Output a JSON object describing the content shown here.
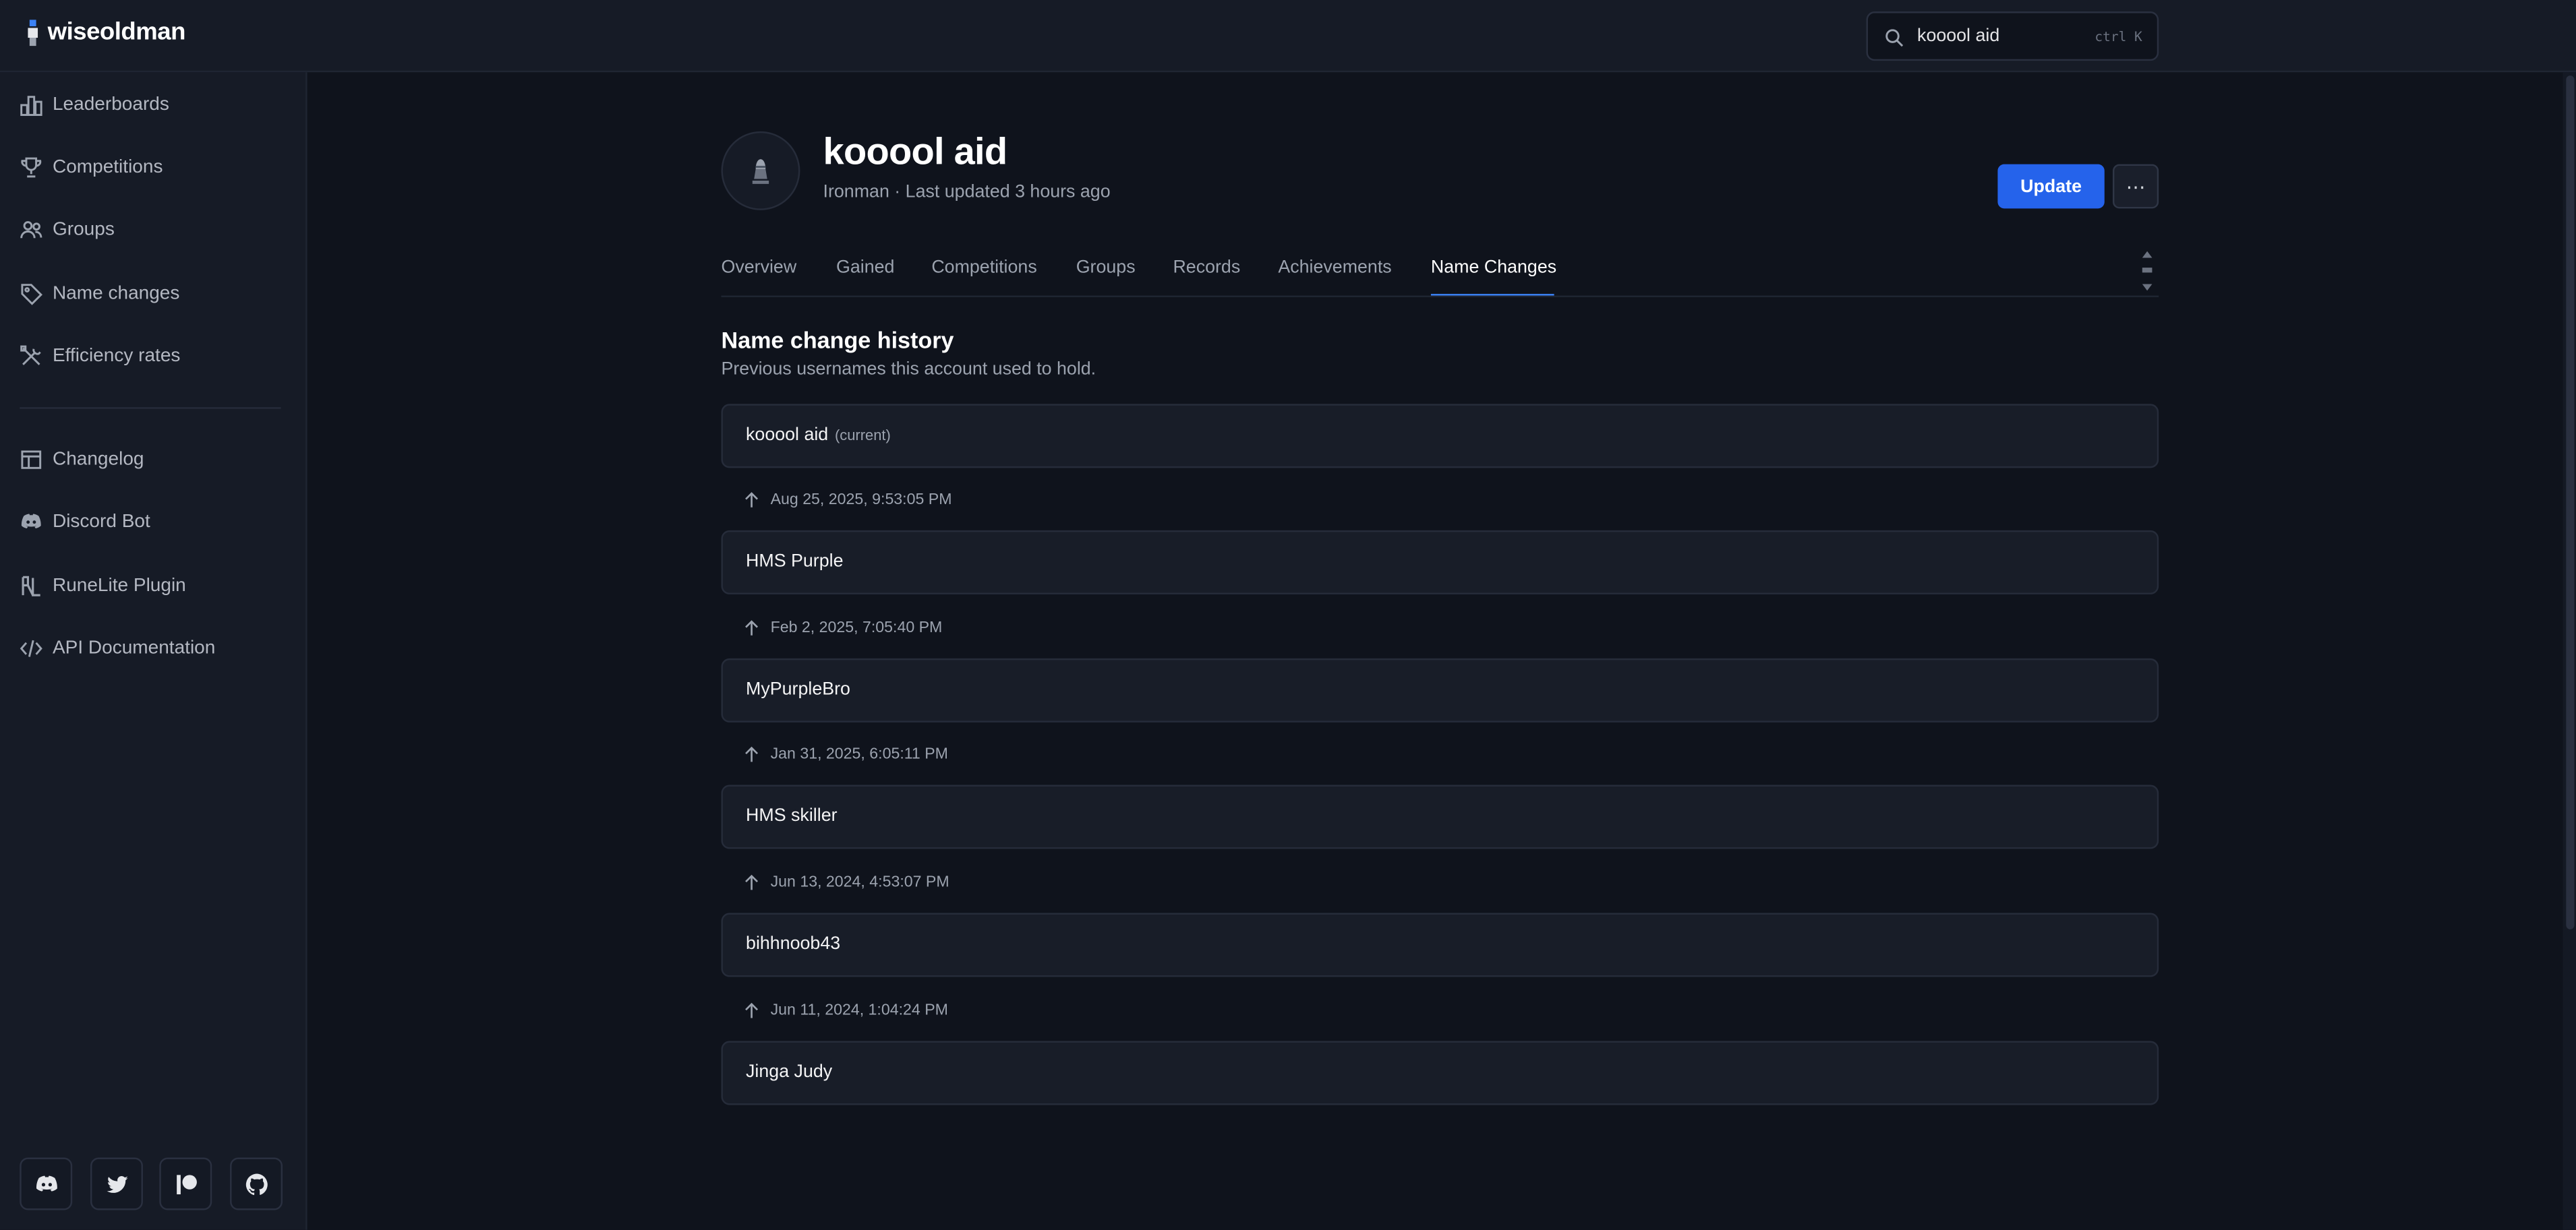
{
  "brand": {
    "name": "wiseoldman"
  },
  "search": {
    "value": "kooool aid",
    "shortcut": "ctrl K"
  },
  "sidebar": {
    "primary": [
      {
        "label": "Leaderboards",
        "icon": "bar-chart-icon"
      },
      {
        "label": "Competitions",
        "icon": "trophy-icon"
      },
      {
        "label": "Groups",
        "icon": "users-icon"
      },
      {
        "label": "Name changes",
        "icon": "tag-icon"
      },
      {
        "label": "Efficiency rates",
        "icon": "tools-icon"
      }
    ],
    "secondary": [
      {
        "label": "Changelog",
        "icon": "changelog-icon"
      },
      {
        "label": "Discord Bot",
        "icon": "discord-icon"
      },
      {
        "label": "RuneLite Plugin",
        "icon": "runelite-icon"
      },
      {
        "label": "API Documentation",
        "icon": "code-icon"
      }
    ],
    "social": [
      "discord-icon",
      "twitter-icon",
      "patreon-icon",
      "github-icon"
    ]
  },
  "player": {
    "name": "kooool aid",
    "subtitle": "Ironman · Last updated 3 hours ago",
    "update_label": "Update",
    "more_label": "⋯"
  },
  "tabs": [
    "Overview",
    "Gained",
    "Competitions",
    "Groups",
    "Records",
    "Achievements",
    "Name Changes"
  ],
  "active_tab": "Name Changes",
  "history": {
    "title": "Name change history",
    "description": "Previous usernames this account used to hold.",
    "current_tag": "(current)",
    "names": [
      "kooool aid",
      "HMS Purple",
      "MyPurpleBro",
      "HMS skiller",
      "bihhnoob43",
      "Jinga Judy"
    ],
    "dates": [
      "Aug 25, 2025, 9:53:05 PM",
      "Feb 2, 2025, 7:05:40 PM",
      "Jan 31, 2025, 6:05:11 PM",
      "Jun 13, 2024, 4:53:07 PM",
      "Jun 11, 2024, 1:04:24 PM"
    ]
  },
  "colors": {
    "accent": "#2563eb",
    "background": "#0f131c",
    "panel": "#161b26"
  }
}
